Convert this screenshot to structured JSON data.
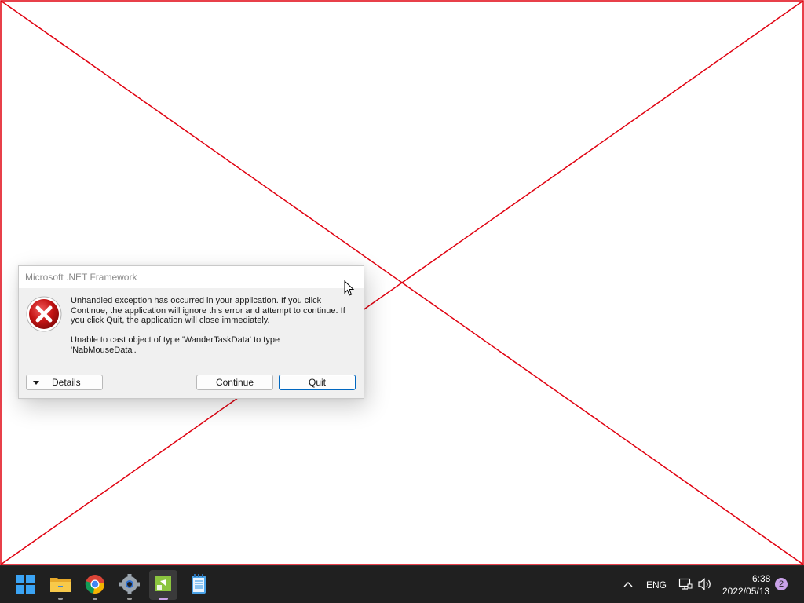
{
  "dialog": {
    "title": "Microsoft .NET Framework",
    "message_line1": "Unhandled exception has occurred in your application. If you click Continue, the application will ignore this error and attempt to continue. If you click Quit, the application will close immediately.",
    "message_line2": "Unable to cast object of type 'WanderTaskData' to type 'NabMouseData'.",
    "details_label": "Details",
    "continue_label": "Continue",
    "quit_label": "Quit",
    "icon": "error-icon"
  },
  "taskbar": {
    "apps": [
      {
        "name": "start",
        "icon": "windows-logo-icon"
      },
      {
        "name": "file-explorer",
        "icon": "folder-icon"
      },
      {
        "name": "chrome",
        "icon": "chrome-icon"
      },
      {
        "name": "settings",
        "icon": "gear-icon"
      },
      {
        "name": "active-app",
        "icon": "app-icon"
      },
      {
        "name": "notepad",
        "icon": "notepad-icon"
      }
    ],
    "tray": {
      "language": "ENG",
      "time": "6:38",
      "date": "2022/05/13",
      "notification_count": "2"
    }
  },
  "colors": {
    "cross_lines": "#e0000f",
    "taskbar_bg": "#202020",
    "accent": "#0067c0"
  }
}
